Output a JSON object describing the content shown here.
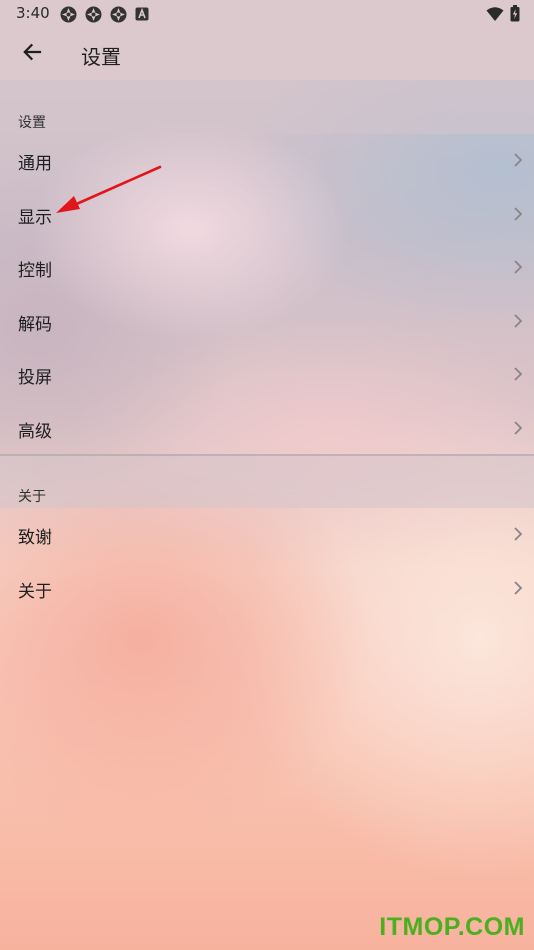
{
  "status_bar": {
    "time": "3:40",
    "left_icons": [
      "app-notification-icon",
      "app-notification-icon",
      "app-notification-icon",
      "a-badge-icon"
    ],
    "right_icons": [
      "wifi-icon",
      "battery-charging-icon"
    ]
  },
  "app_bar": {
    "back_icon": "arrow-left-icon",
    "title": "设置"
  },
  "sections": [
    {
      "header": "设置",
      "items": [
        {
          "label": "通用"
        },
        {
          "label": "显示"
        },
        {
          "label": "控制"
        },
        {
          "label": "解码"
        },
        {
          "label": "投屏"
        },
        {
          "label": "高级"
        }
      ]
    },
    {
      "header": "关于",
      "items": [
        {
          "label": "致谢"
        },
        {
          "label": "关于"
        }
      ]
    }
  ],
  "annotation": {
    "target": "显示",
    "color": "#e0161c"
  },
  "watermark": {
    "text": "ITMOP.COM",
    "color": "#4caf1f"
  }
}
